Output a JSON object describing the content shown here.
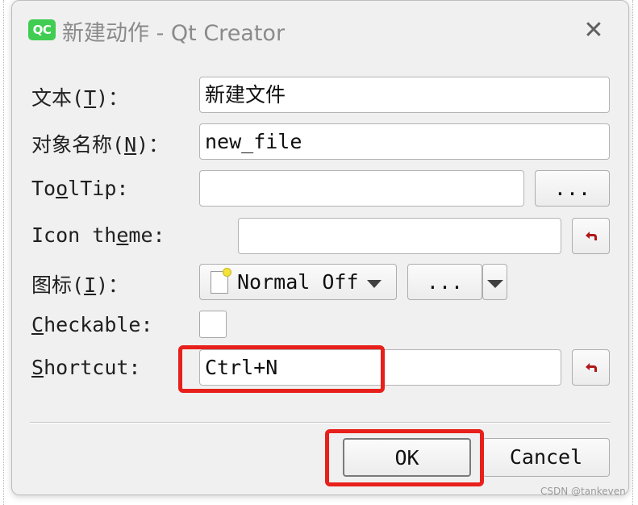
{
  "window": {
    "app_icon_text": "QC",
    "title": "新建动作 - Qt Creator",
    "close_glyph": "✕"
  },
  "form": {
    "text": {
      "label_pre": "文本(",
      "mnemonic": "T",
      "label_post": ")：",
      "value": "新建文件"
    },
    "object_name": {
      "label_pre": "对象名称(",
      "mnemonic": "N",
      "label_post": ")：",
      "value": "new_file"
    },
    "tooltip": {
      "label_pre": "To",
      "mnemonic": "o",
      "label_post": "lTip:",
      "value": "",
      "browse_label": "..."
    },
    "icon_theme": {
      "label_pre": "Icon th",
      "mnemonic": "e",
      "label_post": "me:",
      "value": "",
      "reset_icon": "reset-arrow-icon"
    },
    "icon": {
      "label_pre": "图标(",
      "mnemonic": "I",
      "label_post": ")：",
      "mode_value": "Normal Off",
      "browse_label": "..."
    },
    "checkable": {
      "mnemonic": "C",
      "label_post": "heckable:",
      "checked": false
    },
    "shortcut": {
      "mnemonic": "S",
      "label_post": "hortcut:",
      "value": "Ctrl+N",
      "reset_icon": "reset-arrow-icon"
    }
  },
  "buttons": {
    "ok_label": "OK",
    "cancel_label": "Cancel"
  },
  "watermark": "CSDN @tankeven",
  "colors": {
    "qt_green": "#41cd52",
    "highlight_red": "#e8201c",
    "reset_arrow": "#b01818"
  }
}
